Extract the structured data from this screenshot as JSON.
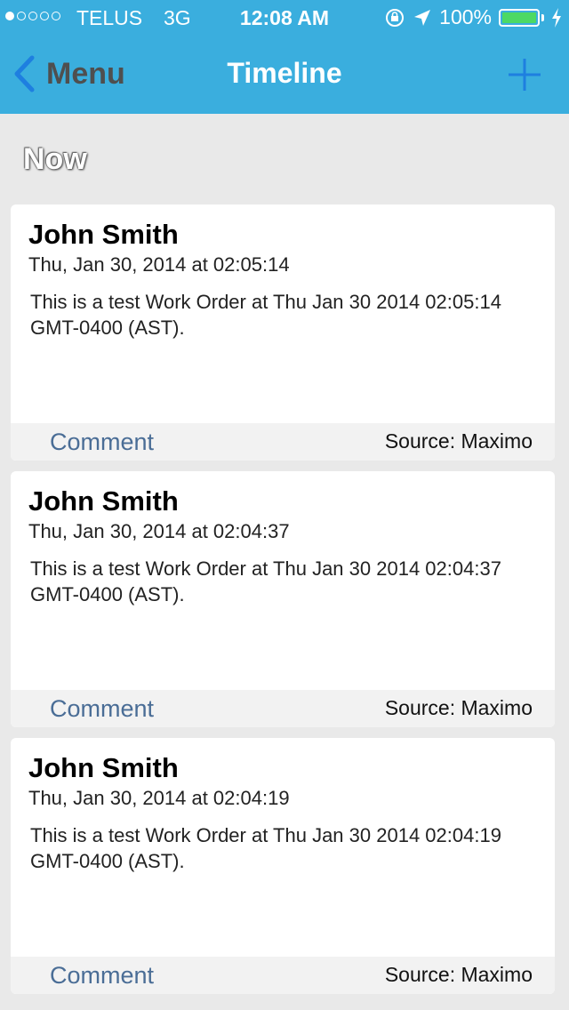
{
  "status_bar": {
    "carrier": "TELUS",
    "network": "3G",
    "time": "12:08 AM",
    "battery": "100%",
    "battery_color": "#4cd964"
  },
  "nav": {
    "back_label": "Menu",
    "title": "Timeline",
    "add_icon": "plus-icon",
    "bar_color": "#3aaede"
  },
  "section": {
    "title": "Now"
  },
  "items": [
    {
      "author": "John Smith",
      "timestamp": "Thu, Jan 30, 2014 at 02:05:14",
      "body": "This is a test Work Order at Thu Jan 30 2014 02:05:14 GMT-0400 (AST).",
      "action": "Comment",
      "source": "Source: Maximo"
    },
    {
      "author": "John Smith",
      "timestamp": "Thu, Jan 30, 2014 at 02:04:37",
      "body": "This is a test Work Order at Thu Jan 30 2014 02:04:37 GMT-0400 (AST).",
      "action": "Comment",
      "source": "Source: Maximo"
    },
    {
      "author": "John Smith",
      "timestamp": "Thu, Jan 30, 2014 at 02:04:19",
      "body": "This is a test Work Order at Thu Jan 30 2014 02:04:19 GMT-0400 (AST).",
      "action": "Comment",
      "source": "Source: Maximo"
    }
  ]
}
